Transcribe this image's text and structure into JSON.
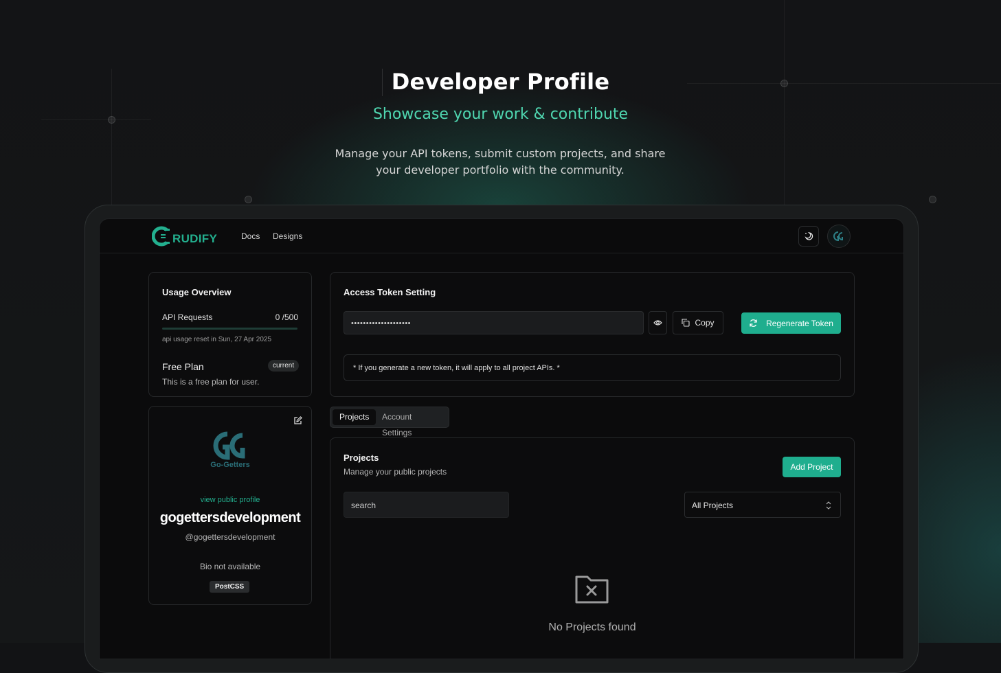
{
  "hero": {
    "title": "Developer Profile",
    "subtitle": "Showcase your work & contribute",
    "description": "Manage your API tokens, submit custom projects, and share your developer portfolio with the community."
  },
  "nav": {
    "brand": "RUDIFY",
    "links": [
      "Docs",
      "Designs"
    ],
    "theme_icon": "moon-sun-icon",
    "avatar_icon": "go-getters-logo"
  },
  "usage": {
    "title": "Usage Overview",
    "api_label": "API Requests",
    "api_used": 0,
    "api_count": "0 /500",
    "api_progress": 0,
    "reset_text": "api usage reset in Sun, 27 Apr 2025",
    "plan_name": "Free Plan",
    "plan_badge": "current",
    "plan_desc": "This is a free plan for user."
  },
  "profile": {
    "edit_icon": "edit-icon",
    "logo_text": "Go-Getters",
    "view_link": "view public profile",
    "name": "gogettersdevelopment",
    "handle": "@gogettersdevelopment",
    "bio": "Bio not available",
    "tag": "PostCSS"
  },
  "access": {
    "title": "Access Token Setting",
    "token_masked": "••••••••••••••••••••",
    "show_icon": "eye-icon",
    "copy_label": "Copy",
    "regen_label": "Regenerate Token",
    "note": "* If you generate a new token, it will apply to all project APIs. *"
  },
  "tabs": {
    "projects": "Projects",
    "account": "Account Settings"
  },
  "projects": {
    "title": "Projects",
    "subtitle": "Manage your public projects",
    "add_label": "Add Project",
    "search_placeholder": "search",
    "filter_value": "All Projects",
    "empty_icon": "folder-x-icon",
    "empty_text": "No Projects found"
  },
  "colors": {
    "accent": "#1fae8e",
    "hero_subtitle": "#4fd6b0",
    "background": "#121315"
  }
}
